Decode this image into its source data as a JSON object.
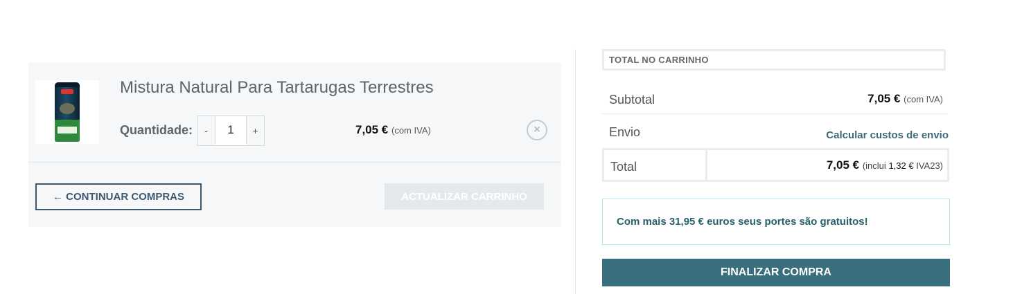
{
  "cart": {
    "product": {
      "name": "Mistura Natural Para Tartarugas Terrestres",
      "image_icon": "product-can-icon",
      "quantity_label": "Quantidade:",
      "quantity_value": "1",
      "decrease_label": "-",
      "increase_label": "+",
      "price": "7,05 €",
      "price_tax_note": "(com IVA)",
      "remove_symbol": "×"
    },
    "continue_label": "← CONTINUAR COMPRAS",
    "update_label": "ACTUALIZAR CARRINHO"
  },
  "totals": {
    "header": "TOTAL NO CARRINHO",
    "subtotal_label": "Subtotal",
    "subtotal_value": "7,05 €",
    "subtotal_tax_note": "(com IVA)",
    "shipping_label": "Envio",
    "shipping_link": "Calcular custos de envio",
    "total_label": "Total",
    "total_value": "7,05 €",
    "total_tax_prefix": "(inclui",
    "total_tax_amount": "1,32 €",
    "total_tax_suffix": "IVA23)",
    "free_shipping_notice": "Com mais 31,95 € euros seus portes são gratuitos!",
    "checkout_label": "FINALIZAR COMPRA"
  },
  "colors": {
    "accent": "#3a6f7e",
    "panel_bg": "#f5f7f9",
    "link": "#3d6a78",
    "notice_border": "#b9e6f0"
  }
}
